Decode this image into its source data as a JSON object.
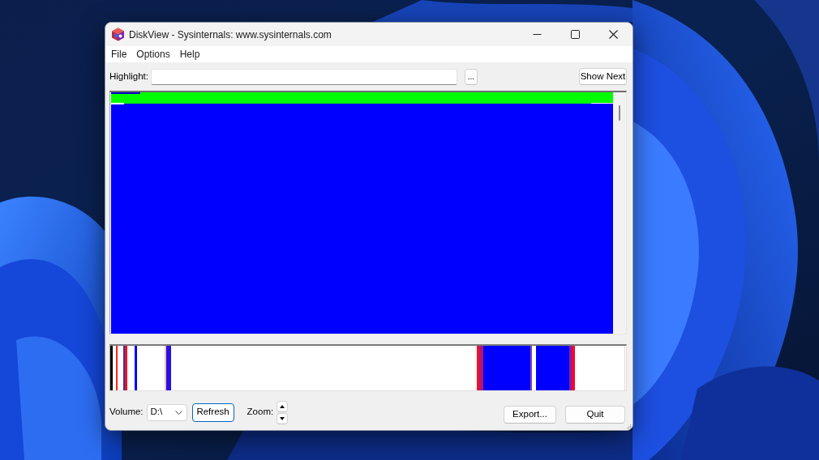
{
  "window": {
    "title": "DiskView - Sysinternals: www.sysinternals.com"
  },
  "menu": [
    "File",
    "Options",
    "Help"
  ],
  "toolbar": {
    "highlight_label": "Highlight:",
    "browse_button": "...",
    "show_next_button": "Show Next"
  },
  "bottom_bar": {
    "volume_label": "Volume:",
    "volume": "D:\\",
    "refresh_button": {
      "label": "Refresh",
      "focused": true
    },
    "zoom_label": "Zoom:",
    "export_button": "Export...",
    "quit_button": "Quit"
  }
}
